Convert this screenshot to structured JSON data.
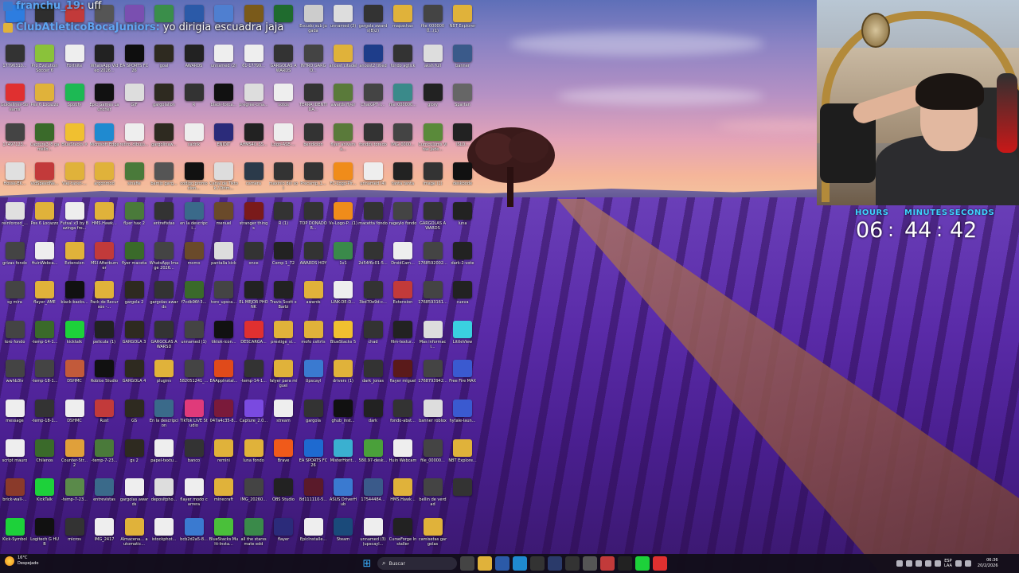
{
  "chat": {
    "line1": {
      "user": "franchu_19:",
      "message": "uff"
    },
    "line2": {
      "user": "ClubAtleticoBocaJuniors:",
      "message": "yo dirigia escuadra jaja"
    }
  },
  "clock": {
    "hours_label": "HOURS",
    "minutes_label": "MINUTES",
    "seconds_label": "SECONDS",
    "hours": "06",
    "minutes": "44",
    "seconds": "42",
    "separator": ":"
  },
  "taskbar": {
    "weather_temp": "16°C",
    "weather_desc": "Despejado",
    "search_label": "Buscar",
    "lang_line1": "ESP",
    "lang_line2": "LAA",
    "time": "06:36",
    "date": "20/2/2026"
  },
  "desktop_icons": [
    {
      "label": "",
      "color": "#2d7de0"
    },
    {
      "label": "",
      "color": "#2e2e2e"
    },
    {
      "label": "",
      "color": "#c23a3a"
    },
    {
      "label": "",
      "color": "#555"
    },
    {
      "label": "",
      "color": "#7a4fb0"
    },
    {
      "label": "",
      "color": "#3a8e4a"
    },
    {
      "label": "",
      "color": "#2b5aa8"
    },
    {
      "label": "",
      "color": "#4f7fd0"
    },
    {
      "label": "",
      "color": "#7a5a1a"
    },
    {
      "label": "",
      "color": "#1f6b2e"
    },
    {
      "label": "Escudo sub jugada",
      "color": "#ccc"
    },
    {
      "label": "unnamed (3)",
      "color": "#ddd"
    },
    {
      "label": "gargola awards(B)2)",
      "color": "#333"
    },
    {
      "label": "mapashax",
      "color": "#e0b23a"
    },
    {
      "label": "file_0000000...(1)",
      "color": "#444"
    },
    {
      "label": "NBT Explorer",
      "color": "#e0b23a"
    },
    {
      "label": "17796310...",
      "color": "#333"
    },
    {
      "label": "Pro Evolution Soccer 6",
      "color": "#8ac23a"
    },
    {
      "label": "Fortnite",
      "color": "#eee"
    },
    {
      "label": "WhatsApp Video 2026...",
      "color": "#222"
    },
    {
      "label": "EA SPORTS FC 26",
      "color": "#0e0e0e"
    },
    {
      "label": "goal",
      "color": "#2e2a20"
    },
    {
      "label": "AWARDS",
      "color": "#222"
    },
    {
      "label": "unnamed (2)",
      "color": "#eee"
    },
    {
      "label": "61-17799...",
      "color": "#eee"
    },
    {
      "label": "GARGOLAS AWARDS",
      "color": "#333"
    },
    {
      "label": "INTRO GARGO...",
      "color": "#444"
    },
    {
      "label": "ancest citadel",
      "color": "#e0b23a"
    },
    {
      "label": "ancest2 titled",
      "color": "#1e3d8a"
    },
    {
      "label": "fondo agtick",
      "color": "#333"
    },
    {
      "label": "aksh full",
      "color": "#ddd"
    },
    {
      "label": "banner",
      "color": "#3a5a8a"
    },
    {
      "label": "Guidelines-Streams",
      "color": "#e03030"
    },
    {
      "label": "Pes 6 Locazzo",
      "color": "#e0b23a"
    },
    {
      "label": "Spotify",
      "color": "#1db954"
    },
    {
      "label": "Epic Games Launcher",
      "color": "#111"
    },
    {
      "label": "GIF",
      "color": "#ddd"
    },
    {
      "label": "gargolallon",
      "color": "#2e2a20"
    },
    {
      "label": "R",
      "color": "#333"
    },
    {
      "label": "black-torca...",
      "color": "#111"
    },
    {
      "label": "pregree-cma...",
      "color": "#ddd"
    },
    {
      "label": "votos",
      "color": "#eee"
    },
    {
      "label": "TERRA IDENTIDA...",
      "color": "#333"
    },
    {
      "label": "awards flyer",
      "color": "#5a7a3a"
    },
    {
      "label": "ChatGPT_I...",
      "color": "#444"
    },
    {
      "label": "file_000000...",
      "color": "#3a8a8a"
    },
    {
      "label": "glory",
      "color": "#222"
    },
    {
      "label": "Spartan",
      "color": "#666"
    },
    {
      "label": "17497123...",
      "color": "#444"
    },
    {
      "label": "Capture3_8 garcello...",
      "color": "#3a6a2a"
    },
    {
      "label": "BlueStacks X",
      "color": "#f0c030"
    },
    {
      "label": "Microsoft Edge",
      "color": "#1f8ad0"
    },
    {
      "label": "retiro_dibuju...",
      "color": "#eee"
    },
    {
      "label": "gargolinaw...",
      "color": "#2e2a20"
    },
    {
      "label": "sadrik",
      "color": "#eee"
    },
    {
      "label": "ENIDIT",
      "color": "#2b2b7a"
    },
    {
      "label": "AffMS40_SS...",
      "color": "#222"
    },
    {
      "label": "Logo-ASE-...",
      "color": "#eee"
    },
    {
      "label": "bendicion",
      "color": "#333"
    },
    {
      "label": "flyer aniversa...",
      "color": "#5a7a3a"
    },
    {
      "label": "fondos toredo",
      "color": "#333"
    },
    {
      "label": "IMG_0000...",
      "color": "#444"
    },
    {
      "label": "Curriculums Vitae Jade...",
      "color": "#5a8a3a"
    },
    {
      "label": "ISLO...",
      "color": "#222"
    },
    {
      "label": "Hosse-EK...",
      "color": "#e0e0e0"
    },
    {
      "label": "VidSpeedNe...",
      "color": "#c23a3a"
    },
    {
      "label": "Viej-tanet-...",
      "color": "#e0b23a"
    },
    {
      "label": "argonmod",
      "color": "#e0b23a"
    },
    {
      "label": "sinafie",
      "color": "#4a7a3a"
    },
    {
      "label": "bamjo garg...",
      "color": "#555"
    },
    {
      "label": "codigo promocion...",
      "color": "#111"
    },
    {
      "label": "Canal de Tiktok / Drim...",
      "color": "#ddd"
    },
    {
      "label": "camera",
      "color": "#2b3a4a"
    },
    {
      "label": "maxinio del sol",
      "color": "#333"
    },
    {
      "label": "Precamp_1...",
      "color": "#333"
    },
    {
      "label": "FC-Logo-Pir...",
      "color": "#f08c1a"
    },
    {
      "label": "unnamed (4)",
      "color": "#eee"
    },
    {
      "label": "tanta tanta",
      "color": "#222"
    },
    {
      "label": "image (1)",
      "color": "#333"
    },
    {
      "label": "deskbode",
      "color": "#111"
    },
    {
      "label": "reinforced_...",
      "color": "#e0e0e0"
    },
    {
      "label": "Pes 6 Locazzo",
      "color": "#e0b23a"
    },
    {
      "label": "Futsal x3 by Bazinga fro...",
      "color": "#eee"
    },
    {
      "label": "HMS.Hawk...",
      "color": "#e0b23a"
    },
    {
      "label": "flyer hax 2",
      "color": "#4a7a3a"
    },
    {
      "label": "entrefistas",
      "color": "#333"
    },
    {
      "label": "en la descripci...",
      "color": "#3a6a8a"
    },
    {
      "label": "menuel",
      "color": "#6a4a2a"
    },
    {
      "label": "stranger things",
      "color": "#7a1a1a"
    },
    {
      "label": "R (1)",
      "color": "#333"
    },
    {
      "label": "TOP DONADOR...",
      "color": "#333"
    },
    {
      "label": "Vs-Logo-P...(1)",
      "color": "#f08c1a"
    },
    {
      "label": "macetta fondo",
      "color": "#333"
    },
    {
      "label": "rageylo fondo",
      "color": "#444"
    },
    {
      "label": "GARGOLAS AWARDS",
      "color": "#333"
    },
    {
      "label": "luna",
      "color": "#222"
    },
    {
      "label": "grizas fondo",
      "color": "#444"
    },
    {
      "label": "HuinWebca...",
      "color": "#eee"
    },
    {
      "label": "Extension",
      "color": "#e0b23a"
    },
    {
      "label": "MSI Afterburner",
      "color": "#c23a3a"
    },
    {
      "label": "flyer maceta",
      "color": "#3a6a2a"
    },
    {
      "label": "WhatsApp Image 2026...",
      "color": "#444"
    },
    {
      "label": "momo",
      "color": "#6a4a2a"
    },
    {
      "label": "pantalla kick",
      "color": "#ddd"
    },
    {
      "label": "once",
      "color": "#333"
    },
    {
      "label": "Comp 1_72",
      "color": "#222"
    },
    {
      "label": "AWARDS HOY",
      "color": "#333"
    },
    {
      "label": "1v1",
      "color": "#3a8a4a"
    },
    {
      "label": "2d54f6c01-5...",
      "color": "#333"
    },
    {
      "label": "DroidCam...",
      "color": "#eee"
    },
    {
      "label": "1768592002...",
      "color": "#444"
    },
    {
      "label": "dark-2-vote",
      "color": "#222"
    },
    {
      "label": "sg mira",
      "color": "#444"
    },
    {
      "label": "flayer_AME",
      "color": "#e0b23a"
    },
    {
      "label": "black-backs...",
      "color": "#111"
    },
    {
      "label": "Pack de Recursos -...",
      "color": "#e0b23a"
    },
    {
      "label": "gargola 2",
      "color": "#2e2a20"
    },
    {
      "label": "gargolas awards",
      "color": "#333"
    },
    {
      "label": "f7cdb96f-3...",
      "color": "#3a6a2a"
    },
    {
      "label": "toro_upsca...",
      "color": "#444"
    },
    {
      "label": "EL MEJOR PHONK",
      "color": "#222"
    },
    {
      "label": "Travis Scott x Barbi",
      "color": "#222"
    },
    {
      "label": "awards",
      "color": "#e0b23a"
    },
    {
      "label": "LINK-DE-D...",
      "color": "#eee"
    },
    {
      "label": "3bd70e9d-c...",
      "color": "#333"
    },
    {
      "label": "Extension",
      "color": "#c23a3a"
    },
    {
      "label": "1768593161...",
      "color": "#444"
    },
    {
      "label": "cueva",
      "color": "#222"
    },
    {
      "label": "toro fondo",
      "color": "#444"
    },
    {
      "label": "-temp-14-1...",
      "color": "#3a6a2a"
    },
    {
      "label": "kicktalk",
      "color": "#1dd13a"
    },
    {
      "label": "pelicula (1)",
      "color": "#222"
    },
    {
      "label": "GARGOLA 3",
      "color": "#2e2a20"
    },
    {
      "label": "GARGOLAS AWARSD",
      "color": "#333"
    },
    {
      "label": "unnamed (1)",
      "color": "#444"
    },
    {
      "label": "tiktok-icon...",
      "color": "#111"
    },
    {
      "label": "DESCARGA...",
      "color": "#e03030"
    },
    {
      "label": "prestige_si...",
      "color": "#e0b23a"
    },
    {
      "label": "mofo csttrts",
      "color": "#e0b23a"
    },
    {
      "label": "BlueStacks 5",
      "color": "#f0c030"
    },
    {
      "label": "chad",
      "color": "#333"
    },
    {
      "label": "film-textur...",
      "color": "#222"
    },
    {
      "label": "Mas informaci...",
      "color": "#ddd"
    },
    {
      "label": "LittleView",
      "color": "#3ad0e0"
    },
    {
      "label": "wwhb3lv",
      "color": "#444"
    },
    {
      "label": "-temp-18-1...",
      "color": "#444"
    },
    {
      "label": "DSHMC",
      "color": "#c25a3a"
    },
    {
      "label": "Roblox Studio",
      "color": "#111"
    },
    {
      "label": "GARGOLA 4",
      "color": "#2e2a20"
    },
    {
      "label": "plugins",
      "color": "#e0b23a"
    },
    {
      "label": "582051241_...",
      "color": "#444"
    },
    {
      "label": "EAAppInstal...",
      "color": "#e04a1a"
    },
    {
      "label": "-temp-14-1...",
      "color": "#333"
    },
    {
      "label": "falyer para miguel",
      "color": "#e0b23a"
    },
    {
      "label": "Upscayl",
      "color": "#3a7ad0"
    },
    {
      "label": "drivers (1)",
      "color": "#e0b23a"
    },
    {
      "label": "dark_jonas",
      "color": "#333"
    },
    {
      "label": "flayer miguel",
      "color": "#5a1a1a"
    },
    {
      "label": "1768793942...",
      "color": "#444"
    },
    {
      "label": "Free Fire MAX",
      "color": "#3a5ad0"
    },
    {
      "label": "message",
      "color": "#eee"
    },
    {
      "label": "-temp-18-1...",
      "color": "#333"
    },
    {
      "label": "DSHMC",
      "color": "#eee"
    },
    {
      "label": "Rust",
      "color": "#c23a3a"
    },
    {
      "label": "GS",
      "color": "#2e2a20"
    },
    {
      "label": "En la descripcion",
      "color": "#3a6a8a"
    },
    {
      "label": "TikTok LIVE Studio",
      "color": "#e03a7a"
    },
    {
      "label": "047a4c35-8...",
      "color": "#7a1a3a"
    },
    {
      "label": "Capture_2.0...",
      "color": "#7a4ae0"
    },
    {
      "label": "stream",
      "color": "#eee"
    },
    {
      "label": "gargola",
      "color": "#333"
    },
    {
      "label": "ghub_inst...",
      "color": "#111"
    },
    {
      "label": "dark",
      "color": "#222"
    },
    {
      "label": "fondo-abst...",
      "color": "#333"
    },
    {
      "label": "banner roblox",
      "color": "#ddd"
    },
    {
      "label": "hytale-laun...",
      "color": "#3a5ad0"
    },
    {
      "label": "script mauro",
      "color": "#eee"
    },
    {
      "label": "Chilenos",
      "color": "#3a6a2a"
    },
    {
      "label": "Counter-Str... 2",
      "color": "#e0a03a"
    },
    {
      "label": "-temp-7-23...",
      "color": "#4a7a3a"
    },
    {
      "label": "gs 2",
      "color": "#2e2a20"
    },
    {
      "label": "papel-textu...",
      "color": "#eee"
    },
    {
      "label": "banco",
      "color": "#333"
    },
    {
      "label": "remini",
      "color": "#e0b23a"
    },
    {
      "label": "luna fondo",
      "color": "#e0b23a"
    },
    {
      "label": "Brave",
      "color": "#f05a1a"
    },
    {
      "label": "EA SPORTS FC 26",
      "color": "#1e6ad0"
    },
    {
      "label": "MisterHorit...",
      "color": "#3ab0d0"
    },
    {
      "label": "580.97-desk...",
      "color": "#4aa03a"
    },
    {
      "label": "Huin Webcam",
      "color": "#eee"
    },
    {
      "label": "file_00000...",
      "color": "#444"
    },
    {
      "label": "NBT Explore...",
      "color": "#e0b23a"
    },
    {
      "label": "brick-wall-...",
      "color": "#8a3a2a"
    },
    {
      "label": "KickTalk",
      "color": "#1dd13a"
    },
    {
      "label": "-temp-7-23...",
      "color": "#5a8a4a"
    },
    {
      "label": "entrevistas",
      "color": "#3a6a8a"
    },
    {
      "label": "gargolas awards",
      "color": "#eee"
    },
    {
      "label": "depositpho...",
      "color": "#ddd"
    },
    {
      "label": "flayer modo carrera",
      "color": "#eee"
    },
    {
      "label": "minecraft",
      "color": "#e0b23a"
    },
    {
      "label": "IMG_20260...",
      "color": "#444"
    },
    {
      "label": "OBS Studio",
      "color": "#222"
    },
    {
      "label": "8d111110-5...",
      "color": "#5a1a2a"
    },
    {
      "label": "ASUS DriverHub",
      "color": "#3a7ad0"
    },
    {
      "label": "17544484...",
      "color": "#3a5a8a"
    },
    {
      "label": "HMS.Hawk...",
      "color": "#e0b23a"
    },
    {
      "label": "bellin de verdad",
      "color": "#444"
    },
    {
      "label": "",
      "color": "#333"
    },
    {
      "label": "Kick-Symbol",
      "color": "#1dd13a"
    },
    {
      "label": "Logitech G HUB",
      "color": "#111"
    },
    {
      "label": "micros",
      "color": "#333"
    },
    {
      "label": "IMG_2417",
      "color": "#eee"
    },
    {
      "label": "Almacena... automatic...",
      "color": "#e0b23a"
    },
    {
      "label": "istockphot...",
      "color": "#eee"
    },
    {
      "label": "bcb2d2a5-8...",
      "color": "#3a7ad0"
    },
    {
      "label": "BlueStacks Multi-Insta...",
      "color": "#4ac03a"
    },
    {
      "label": "all the starss mate edd",
      "color": "#3a8a4a"
    },
    {
      "label": "flayer",
      "color": "#2b2b7a"
    },
    {
      "label": "EpicInstalle...",
      "color": "#eee"
    },
    {
      "label": "Steam",
      "color": "#1a4a7a"
    },
    {
      "label": "unnamed (3) (upscayl...",
      "color": "#eee"
    },
    {
      "label": "CurseForge Installer",
      "color": "#222"
    },
    {
      "label": "camisetas gargolas",
      "color": "#e0b23a"
    }
  ]
}
